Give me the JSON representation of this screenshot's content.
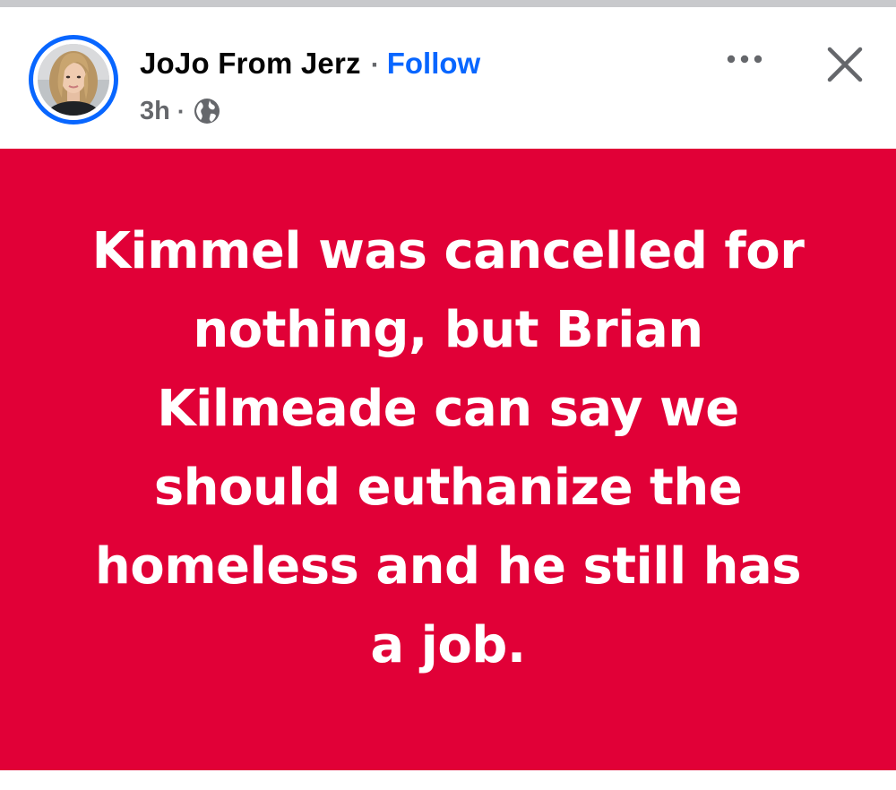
{
  "post": {
    "author_name": "JoJo From Jerz",
    "separator": "·",
    "follow_label": "Follow",
    "timestamp": "3h",
    "meta_separator": "·",
    "audience_icon": "globe-icon",
    "more_icon": "more-horizontal-icon",
    "close_icon": "close-icon",
    "avatar": "profile-photo"
  },
  "card": {
    "background_color": "#e10037",
    "text_color": "#ffffff",
    "text": "Kimmel was cancelled for nothing, but Brian Kilmeade can say we should euthanize the homeless and he still has a job."
  },
  "colors": {
    "accent": "#0866ff",
    "secondary_text": "#65676b",
    "primary_text": "#050505"
  }
}
